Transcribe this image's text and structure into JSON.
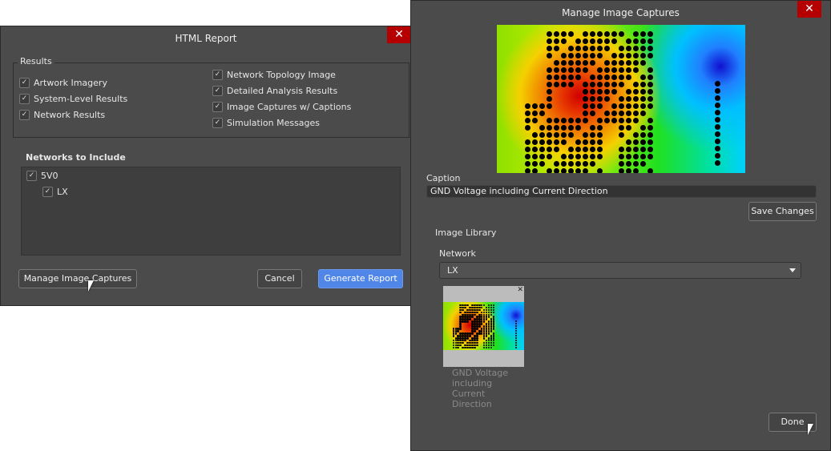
{
  "html_report": {
    "title": "HTML Report",
    "close": "✕",
    "results_label": "Results",
    "results_left": [
      {
        "label": "Artwork Imagery",
        "checked": true
      },
      {
        "label": "System-Level Results",
        "checked": true
      },
      {
        "label": "Network Results",
        "checked": true
      }
    ],
    "results_right": [
      {
        "label": "Network Topology Image",
        "checked": true
      },
      {
        "label": "Detailed Analysis Results",
        "checked": true
      },
      {
        "label": "Image Captures w/ Captions",
        "checked": true
      },
      {
        "label": "Simulation Messages",
        "checked": true
      }
    ],
    "networks_label": "Networks to Include",
    "networks": [
      {
        "label": "5V0",
        "checked": true
      },
      {
        "label": "LX",
        "checked": true
      }
    ],
    "manage_button": "Manage Image Captures",
    "cancel_button": "Cancel",
    "generate_button": "Generate Report"
  },
  "captures": {
    "title": "Manage Image Captures",
    "close": "✕",
    "caption_label": "Caption",
    "caption_value": "GND Voltage including Current Direction",
    "save_button": "Save Changes",
    "library_label": "Image Library",
    "network_label": "Network",
    "network_value": "LX",
    "thumb_close": "✕",
    "thumb_caption": "GND Voltage including Current Direction",
    "done_button": "Done"
  },
  "colors": {
    "accent": "#4f86e8",
    "close": "#b40000"
  }
}
